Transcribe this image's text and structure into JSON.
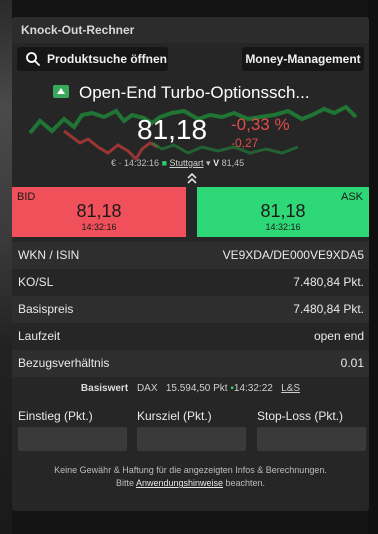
{
  "panel": {
    "title": "Knock-Out-Rechner"
  },
  "toolbar": {
    "search_label": "Produktsuche öffnen",
    "money_label": "Money-Management"
  },
  "product": {
    "name": "Open-End Turbo-Optionssch...",
    "price": "81,18",
    "change_pct": "-0,33 %",
    "change_abs": "-0,27",
    "currency_time": "€ · 14:32:16",
    "exchange": "Stuttgart",
    "volume_label": "V",
    "volume": "81,45"
  },
  "quotes": {
    "bid_label": "BID",
    "bid_price": "81,18",
    "bid_time": "14:32:16",
    "ask_label": "ASK",
    "ask_price": "81,18",
    "ask_time": "14:32:16"
  },
  "details": [
    {
      "label": "WKN / ISIN",
      "value": "VE9XDA/DE000VE9XDA5"
    },
    {
      "label": "KO/SL",
      "value": "7.480,84 Pkt."
    },
    {
      "label": "Basispreis",
      "value": "7.480,84 Pkt."
    },
    {
      "label": "Laufzeit",
      "value": "open end"
    },
    {
      "label": "Bezugsverhältnis",
      "value": "0.01"
    }
  ],
  "underlying": {
    "label": "Basiswert",
    "name": "DAX",
    "value": "15.594,50 Pkt",
    "time": "14:32:22",
    "source": "L&S"
  },
  "inputs": {
    "entry_label": "Einstieg (Pkt.)",
    "target_label": "Kursziel (Pkt.)",
    "stoploss_label": "Stop-Loss (Pkt.)",
    "entry_value": "",
    "target_value": "",
    "stoploss_value": ""
  },
  "disclaimer": {
    "line1": "Keine Gewähr & Haftung für die angezeigten Infos & Berechnungen.",
    "line2_pre": "Bitte ",
    "line2_link": "Anwendungshinweise",
    "line2_post": " beachten."
  },
  "colors": {
    "bid": "#f0505a",
    "ask": "#2ed876",
    "negative": "#e24b4b",
    "positive": "#2ecc71"
  }
}
